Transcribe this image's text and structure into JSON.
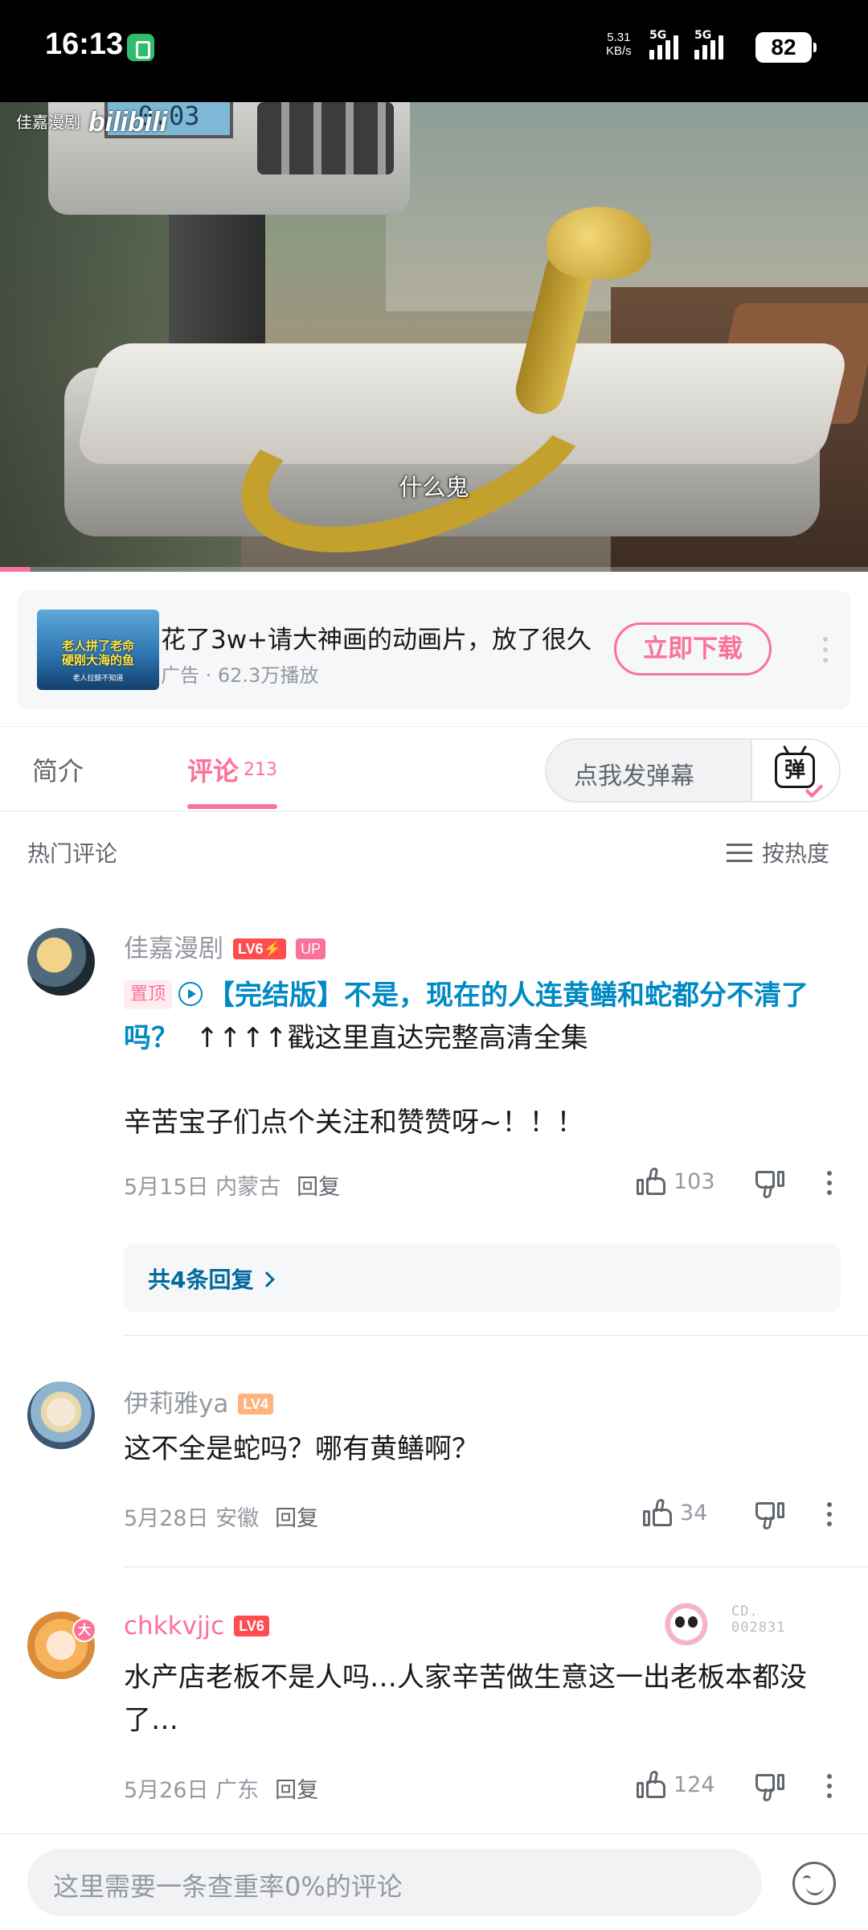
{
  "status_bar": {
    "time": "16:13",
    "speed_value": "5.31",
    "speed_unit": "KB/s",
    "network1": "5G",
    "network2": "5G",
    "battery": "82"
  },
  "video": {
    "watermark_channel": "佳嘉漫剧",
    "watermark_logo": "bilibili",
    "scale_display": "0.03",
    "subtitle": "什么鬼",
    "progress_fraction": 0.035
  },
  "ad": {
    "thumb_line1": "老人拼了老命",
    "thumb_line2": "硬刚大海的鱼",
    "thumb_line3": "老人拉鲸不知道",
    "title": "花了3w+请大神画的动画片，放了很久",
    "meta": "广告 · 62.3万播放",
    "button": "立即下载"
  },
  "tabs": {
    "intro": "简介",
    "comments": "评论",
    "comments_count": "213",
    "danmaku_placeholder": "点我发弹幕",
    "danmaku_icon_char": "弹"
  },
  "comments_header": {
    "title": "热门评论",
    "sort": "按热度"
  },
  "comments": [
    {
      "user": "佳嘉漫剧",
      "level": "LV6⚡",
      "up": "UP",
      "pinned": "置顶",
      "link_text": "【完结版】不是，现在的人连黄鳝和蛇都分不清了吗？",
      "text_after": "↑↑↑↑戳这里直达完整高清全集",
      "text_line2": "辛苦宝子们点个关注和赞赞呀~！！！",
      "date": "5月15日",
      "location": "内蒙古",
      "reply": "回复",
      "likes": "103",
      "replies_summary": "共4条回复"
    },
    {
      "user": "伊莉雅ya",
      "level": "LV4",
      "text": "这不全是蛇吗？哪有黄鳝啊？",
      "date": "5月28日",
      "location": "安徽",
      "reply": "回复",
      "likes": "34"
    },
    {
      "user": "chkkvjjc",
      "level": "LV6",
      "avatar_badge": "大",
      "fan_no_1": "CD.",
      "fan_no_2": "002831",
      "text": "水产店老板不是人吗…人家辛苦做生意这一出老板本都没了…",
      "date": "5月26日",
      "location": "广东",
      "reply": "回复",
      "likes": "124"
    }
  ],
  "input_bar": {
    "placeholder": "这里需要一条查重率0%的评论"
  },
  "colors": {
    "accent": "#fb7299",
    "link": "#008ac5",
    "text": "#18191c",
    "muted": "#9499a0"
  }
}
